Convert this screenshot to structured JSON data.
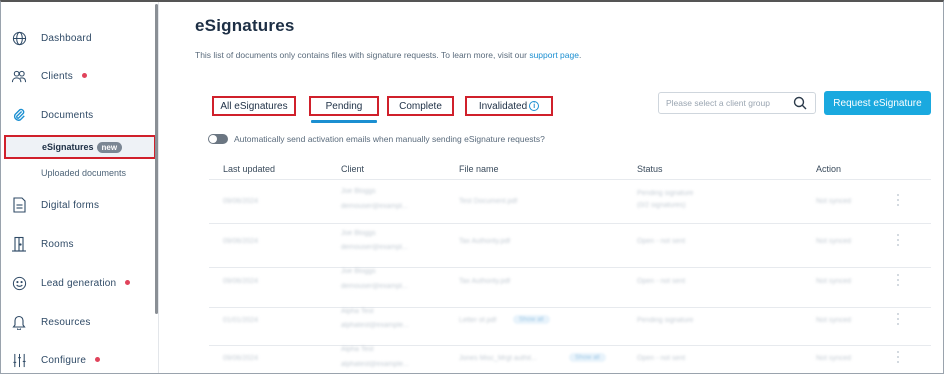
{
  "sidebar": {
    "items": [
      {
        "label": "Dashboard",
        "icon": "globe-icon",
        "dot": false
      },
      {
        "label": "Clients",
        "icon": "users-icon",
        "dot": true
      },
      {
        "label": "Documents",
        "icon": "paperclip-icon",
        "dot": false
      },
      {
        "label": "Digital forms",
        "icon": "form-icon",
        "dot": false
      },
      {
        "label": "Rooms",
        "icon": "rooms-icon",
        "dot": false
      },
      {
        "label": "Lead generation",
        "icon": "smiley-icon",
        "dot": true
      },
      {
        "label": "Resources",
        "icon": "bell-icon",
        "dot": false
      },
      {
        "label": "Configure",
        "icon": "sliders-icon",
        "dot": true
      }
    ],
    "sub_items": [
      {
        "label": "eSignatures",
        "badge": "new",
        "active": true
      },
      {
        "label": "Uploaded documents",
        "active": false
      }
    ]
  },
  "page": {
    "title": "eSignatures",
    "description": "This list of documents only contains files with signature requests. To learn more, visit our ",
    "link_text": "support page",
    "description_end": "."
  },
  "tabs": [
    {
      "label": "All eSignatures"
    },
    {
      "label": "Pending",
      "selected": true
    },
    {
      "label": "Complete"
    },
    {
      "label": "Invalidated"
    }
  ],
  "search": {
    "placeholder": "Please select a client group"
  },
  "request_button": "Request eSignature",
  "auto_toggle": {
    "label": "Automatically send activation emails when manually sending eSignature requests?",
    "on": false
  },
  "table": {
    "headers": [
      "Last updated",
      "Client",
      "File name",
      "Status",
      "Action"
    ],
    "rows": [
      {
        "date": "09/06/2024",
        "client_name": "Joe Bloggs",
        "client_email": "demouser@exampl...",
        "file": "Test Document.pdf",
        "chip": "",
        "status": "Pending signature",
        "status2": "(0/2 signatures)",
        "action": "Not synced"
      },
      {
        "date": "09/06/2024",
        "client_name": "Joe Bloggs",
        "client_email": "demouser@exampl...",
        "file": "Tax Authority.pdf",
        "chip": "",
        "status": "Open - not sent",
        "status2": "",
        "action": "Not synced"
      },
      {
        "date": "09/06/2024",
        "client_name": "Joe Bloggs",
        "client_email": "demouser@exampl...",
        "file": "Tax Authority.pdf",
        "chip": "",
        "status": "Open - not sent",
        "status2": "",
        "action": "Not synced"
      },
      {
        "date": "01/01/2024",
        "client_name": "Alpha Test",
        "client_email": "alphatest@example...",
        "file": "Letter of.pdf",
        "chip": "Show all",
        "status": "Pending signature",
        "status2": "",
        "action": "Not synced"
      },
      {
        "date": "09/06/2024",
        "client_name": "Alpha Test",
        "client_email": "alphatest@example...",
        "file": "Jones Misc_Mrgt authit...",
        "chip": "Show all",
        "status": "Open - not sent",
        "status2": "",
        "action": "Not synced"
      }
    ]
  },
  "colors": {
    "accent": "#1aa9df",
    "highlight": "#d0202b",
    "dot": "#e0435b"
  }
}
